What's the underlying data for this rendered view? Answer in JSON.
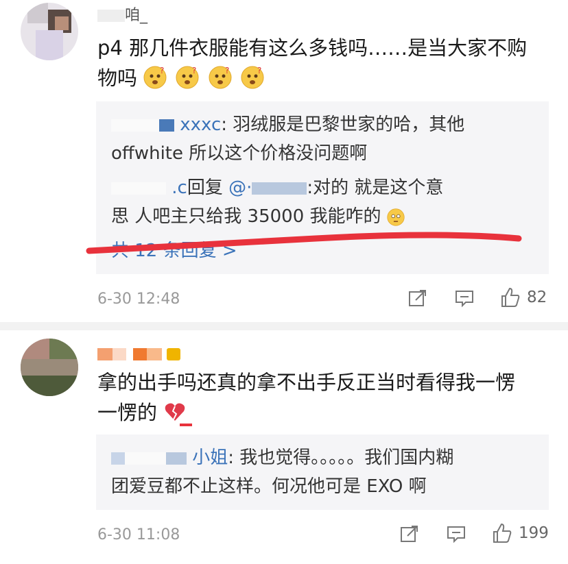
{
  "comments": [
    {
      "username": "咱_",
      "text_line1": "p4 那几件衣服能有这么多钱吗……是当大家不购",
      "text_line2": "物吗",
      "emoji_icon": "thinking-face-icon",
      "replies": [
        {
          "name": "xxxc",
          "text": ": 羽绒服是巴黎世家的哈，其他",
          "text2": "offwhite 所以这个价格没问题啊"
        },
        {
          "name": ".c",
          "reply_word": "回复",
          "at": "@·",
          "text": ":对的 就是这个意",
          "text2": "思 人吧主只给我 35000 我能咋的"
        }
      ],
      "more_replies": "共 12 条回复 >",
      "time": "6-30 12:48",
      "likes": "82"
    },
    {
      "username": "",
      "text_line1": "拿的出手吗还真的拿不出手反正当时看得我一愣",
      "text_line2": "一愣的",
      "emoji_icon": "broken-heart-icon",
      "replies": [
        {
          "name": "小姐",
          "text": ": 我也觉得。。。。。我们国内糊",
          "text2": "团爱豆都不止这样。何况他可是 EXO 啊"
        }
      ],
      "time": "6-30 11:08",
      "likes": "199"
    }
  ],
  "colors": {
    "link": "#3b73b9",
    "annotation_red": "#e8323c",
    "reply_bg": "#f5f5f7"
  }
}
